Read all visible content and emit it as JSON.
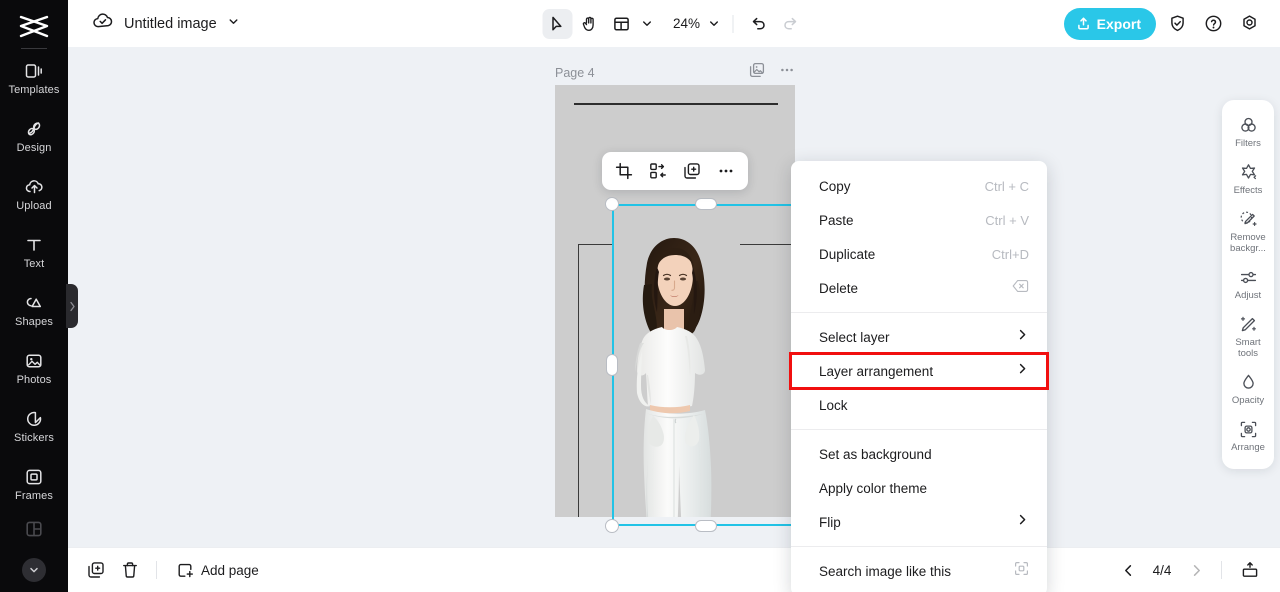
{
  "app": {
    "brand": "capcut-logo",
    "accent_color": "#2ac7e8",
    "highlight_color": "#f10f0f",
    "sidebar_bg": "#0a0a0c",
    "canvas_bg": "#cdcdcd",
    "workspace_bg": "#eef1f5"
  },
  "sidebar": {
    "items": [
      {
        "label": "Templates",
        "icon": "templates-icon"
      },
      {
        "label": "Design",
        "icon": "design-icon"
      },
      {
        "label": "Upload",
        "icon": "upload-cloud-icon"
      },
      {
        "label": "Text",
        "icon": "text-icon"
      },
      {
        "label": "Shapes",
        "icon": "shapes-icon"
      },
      {
        "label": "Photos",
        "icon": "photos-icon"
      },
      {
        "label": "Stickers",
        "icon": "stickers-icon"
      },
      {
        "label": "Frames",
        "icon": "frames-icon"
      }
    ],
    "expand_icon": "chevron-down-icon",
    "collapse_icon": "chevron-right-icon"
  },
  "topbar": {
    "cloud_status_icon": "cloud-saved-icon",
    "document_title": "Untitled image",
    "title_chevron": "chevron-down-icon",
    "tools": [
      {
        "name": "select-tool",
        "icon": "cursor-icon",
        "active": true
      },
      {
        "name": "hand-tool",
        "icon": "hand-icon",
        "active": false
      },
      {
        "name": "layout-tool",
        "icon": "layout-icon",
        "active": false
      }
    ],
    "zoom_level": "24%",
    "undo_icon": "undo-icon",
    "redo_icon": "redo-icon",
    "export_label": "Export",
    "export_icon": "export-upload-icon",
    "right_icons": [
      {
        "name": "shield-check-icon"
      },
      {
        "name": "help-circle-icon"
      },
      {
        "name": "settings-gear-icon"
      }
    ]
  },
  "canvas": {
    "page_label": "Page 4",
    "page_duplicate_icon": "duplicate-page-icon",
    "page_more_icon": "more-horizontal-icon",
    "selected_element": "photo-woman-white-outfit"
  },
  "element_toolbar": {
    "buttons": [
      {
        "name": "crop-button",
        "icon": "crop-icon"
      },
      {
        "name": "replace-button",
        "icon": "replace-icon"
      },
      {
        "name": "duplicate-button",
        "icon": "duplicate-icon"
      },
      {
        "name": "more-button",
        "icon": "more-horizontal-icon"
      }
    ]
  },
  "context_menu": {
    "groups": [
      {
        "items": [
          {
            "label": "Copy",
            "shortcut": "Ctrl + C",
            "submenu": false,
            "highlighted": false
          },
          {
            "label": "Paste",
            "shortcut": "Ctrl + V",
            "submenu": false,
            "highlighted": false
          },
          {
            "label": "Duplicate",
            "shortcut": "Ctrl+D",
            "submenu": false,
            "highlighted": false
          },
          {
            "label": "Delete",
            "shortcut": "",
            "icon": "backspace-icon",
            "submenu": false,
            "highlighted": false
          }
        ]
      },
      {
        "items": [
          {
            "label": "Select layer",
            "shortcut": "",
            "submenu": true,
            "highlighted": false
          },
          {
            "label": "Layer arrangement",
            "shortcut": "",
            "submenu": true,
            "highlighted": true
          },
          {
            "label": "Lock",
            "shortcut": "",
            "submenu": false,
            "highlighted": false
          }
        ]
      },
      {
        "items": [
          {
            "label": "Set as background",
            "shortcut": "",
            "submenu": false,
            "highlighted": false
          },
          {
            "label": "Apply color theme",
            "shortcut": "",
            "submenu": false,
            "highlighted": false
          },
          {
            "label": "Flip",
            "shortcut": "",
            "submenu": true,
            "highlighted": false
          }
        ]
      },
      {
        "items": [
          {
            "label": "Search image like this",
            "shortcut": "",
            "icon": "scan-icon",
            "submenu": false,
            "highlighted": false
          }
        ]
      }
    ]
  },
  "right_panel": {
    "items": [
      {
        "label": "Filters",
        "icon": "filters-icon"
      },
      {
        "label": "Effects",
        "icon": "effects-icon"
      },
      {
        "label": "Remove backgr...",
        "icon": "remove-background-icon"
      },
      {
        "label": "Adjust",
        "icon": "adjust-icon"
      },
      {
        "label": "Smart tools",
        "icon": "smart-tools-icon"
      },
      {
        "label": "Opacity",
        "icon": "opacity-icon"
      },
      {
        "label": "Arrange",
        "icon": "arrange-icon"
      }
    ]
  },
  "bottombar": {
    "duplicate_icon": "duplicate-page-icon",
    "delete_icon": "trash-icon",
    "add_page_label": "Add page",
    "add_page_icon": "add-square-icon",
    "prev_icon": "chevron-left-icon",
    "next_icon": "chevron-right-icon",
    "page_indicator": "4/4",
    "present_icon": "present-icon"
  }
}
